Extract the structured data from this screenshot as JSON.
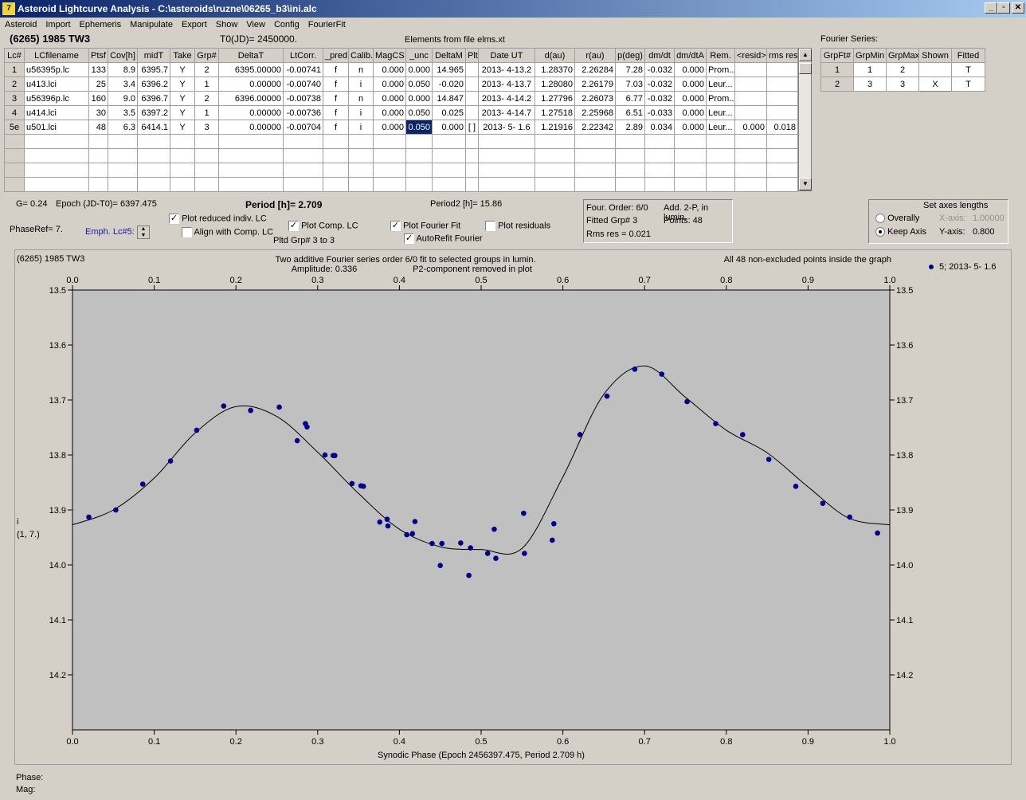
{
  "window": {
    "title": "Asteroid Lightcurve Analysis - C:\\asteroids\\ruzne\\06265_b3\\ini.alc",
    "icon_glyph": "7",
    "minimize": "_",
    "restore": "▫",
    "close": "✕"
  },
  "menu": [
    "Asteroid",
    "Import",
    "Ephemeris",
    "Manipulate",
    "Export",
    "Show",
    "View",
    "Config",
    "FourierFit"
  ],
  "header": {
    "asteroid": "(6265) 1985 TW3",
    "t0": "T0(JD)= 2450000.",
    "elements": "Elements from file elms.xt"
  },
  "lc_table": {
    "columns": [
      "Lc#",
      "LCfilename",
      "Ptsf",
      "Cov[h]",
      "midT",
      "Take",
      "Grp#",
      "DeltaT",
      "LtCorr.",
      "_pred.",
      "Calib.",
      "MagCS",
      "_unc",
      "DeltaM",
      "Plt",
      "Date UT",
      "d(au)",
      "r(au)",
      "p(deg)",
      "dm/dt",
      "dm/dtA",
      "Rem.",
      "<resid>",
      "rms res"
    ],
    "rows": [
      [
        "1",
        "u56395p.lc",
        "133",
        "8.9",
        "6395.7",
        "Y",
        "2",
        "6395.00000",
        "-0.00741",
        "f",
        "n",
        "0.000",
        "0.000",
        "14.965",
        "",
        "2013- 4-13.2",
        "1.28370",
        "2.26284",
        "7.28",
        "-0.032",
        "0.000",
        "Prom...",
        "",
        ""
      ],
      [
        "2",
        "u413.lci",
        "25",
        "3.4",
        "6396.2",
        "Y",
        "1",
        "0.00000",
        "-0.00740",
        "f",
        "i",
        "0.000",
        "0.050",
        "-0.020",
        "",
        "2013- 4-13.7",
        "1.28080",
        "2.26179",
        "7.03",
        "-0.032",
        "0.000",
        "Leur...",
        "",
        ""
      ],
      [
        "3",
        "u56396p.lc",
        "160",
        "9.0",
        "6396.7",
        "Y",
        "2",
        "6396.00000",
        "-0.00738",
        "f",
        "n",
        "0.000",
        "0.000",
        "14.847",
        "",
        "2013- 4-14.2",
        "1.27796",
        "2.26073",
        "6.77",
        "-0.032",
        "0.000",
        "Prom...",
        "",
        ""
      ],
      [
        "4",
        "u414.lci",
        "30",
        "3.5",
        "6397.2",
        "Y",
        "1",
        "0.00000",
        "-0.00736",
        "f",
        "i",
        "0.000",
        "0.050",
        "0.025",
        "",
        "2013- 4-14.7",
        "1.27518",
        "2.25968",
        "6.51",
        "-0.033",
        "0.000",
        "Leur...",
        "",
        ""
      ],
      [
        "5e",
        "u501.lci",
        "48",
        "6.3",
        "6414.1",
        "Y",
        "3",
        "0.00000",
        "-0.00704",
        "f",
        "i",
        "0.000",
        "0.050",
        "0.000",
        "[ ]",
        "2013- 5- 1.6",
        "1.21916",
        "2.22342",
        "2.89",
        "0.034",
        "0.000",
        "Leur...",
        "0.000",
        "0.018"
      ]
    ],
    "empty_rows": 4
  },
  "fourier_series": {
    "label": "Fourier Series:",
    "columns": [
      "GrpFt#",
      "GrpMin",
      "GrpMax",
      "Shown",
      "Fitted"
    ],
    "rows": [
      [
        "1",
        "1",
        "2",
        "",
        "T"
      ],
      [
        "2",
        "3",
        "3",
        "X",
        "T"
      ]
    ]
  },
  "controls": {
    "g": "G= 0.24",
    "epoch": "Epoch (JD-T0)= 6397.475",
    "period": "Period [h]= 2.709",
    "period2": "Period2 [h]= 15.86",
    "phaseref": "PhaseRef= 7.",
    "emph": "Emph. Lc#5:",
    "plot_reduced": "Plot reduced indiv. LC",
    "align_comp": "Align with Comp. LC",
    "plot_comp": "Plot Comp. LC",
    "pltd_grp": "Pltd Grp#  3  to  3",
    "plot_fourier": "Plot Fourier Fit",
    "autorefit": "AutoRefit Fourier",
    "plot_residuals": "Plot residuals",
    "four_order": "Four. Order:  6/0",
    "add_2p": "Add. 2-P, in lumin.",
    "fitted_grp": "Fitted Grp# 3",
    "points": "Points: 48",
    "rms_res": "Rms res    = 0.021",
    "axes_title": "Set axes lengths",
    "overally": "Overally",
    "keep_axis": "Keep Axis",
    "x_axis_label": "X-axis:",
    "x_axis_value": "1.00000",
    "y_axis_label": "Y-axis:",
    "y_axis_value": "0.800"
  },
  "footer": {
    "phase": "Phase:",
    "mag": "Mag:"
  },
  "colors": {
    "titlebar_start": "#0a246a",
    "titlebar_end": "#a6caf0",
    "face": "#d4d0c8",
    "plot_bg": "#c0c0c0",
    "points": "#00008b",
    "selection": "#0a246a"
  },
  "chart_data": {
    "type": "scatter",
    "title": "(6265) 1985 TW3",
    "subtitle_lines": [
      "Two additive Fourier series order 6/0 fit to selected groups in lumin.",
      "Amplitude: 0.336",
      "P2-component removed in plot"
    ],
    "note": "All 48 non-excluded points inside the graph",
    "legend": "5; 2013- 5- 1.6",
    "legend_position": "top-right",
    "xlabel": "Synodic Phase (Epoch 2456397.475, Period 2.709 h)",
    "ylabel_lines": [
      "i",
      "(1, 7.)"
    ],
    "xlim": [
      0.0,
      1.0
    ],
    "ylim": [
      13.5,
      14.3
    ],
    "y_inverted": true,
    "x_ticks": [
      "0.0",
      "0.1",
      "0.2",
      "0.3",
      "0.4",
      "0.5",
      "0.6",
      "0.7",
      "0.8",
      "0.9",
      "1.0"
    ],
    "y_ticks": [
      "13.5",
      "13.6",
      "13.7",
      "13.8",
      "13.9",
      "14.0",
      "14.1",
      "14.2"
    ],
    "points": {
      "x": [
        0.02,
        0.053,
        0.086,
        0.12,
        0.152,
        0.185,
        0.218,
        0.253,
        0.275,
        0.285,
        0.287,
        0.309,
        0.319,
        0.321,
        0.342,
        0.353,
        0.356,
        0.376,
        0.385,
        0.386,
        0.409,
        0.416,
        0.419,
        0.44,
        0.45,
        0.452,
        0.475,
        0.485,
        0.487,
        0.508,
        0.516,
        0.518,
        0.552,
        0.553,
        0.587,
        0.589,
        0.621,
        0.654,
        0.688,
        0.721,
        0.752,
        0.787,
        0.82,
        0.852,
        0.885,
        0.918,
        0.951,
        0.985
      ],
      "y": [
        13.913,
        13.9,
        13.853,
        13.811,
        13.755,
        13.711,
        13.719,
        13.713,
        13.774,
        13.743,
        13.749,
        13.8,
        13.801,
        13.801,
        13.852,
        13.856,
        13.857,
        13.922,
        13.917,
        13.929,
        13.945,
        13.943,
        13.921,
        13.961,
        14.001,
        13.961,
        13.96,
        14.019,
        13.969,
        13.979,
        13.935,
        13.988,
        13.906,
        13.979,
        13.955,
        13.925,
        13.763,
        13.693,
        13.644,
        13.653,
        13.703,
        13.743,
        13.763,
        13.808,
        13.857,
        13.888,
        13.913,
        13.942
      ]
    },
    "fit_curve": {
      "x": [
        0.0,
        0.05,
        0.1,
        0.15,
        0.2,
        0.25,
        0.3,
        0.35,
        0.4,
        0.45,
        0.5,
        0.55,
        0.6,
        0.65,
        0.7,
        0.75,
        0.8,
        0.85,
        0.9,
        0.95,
        1.0
      ],
      "y": [
        13.927,
        13.9,
        13.842,
        13.76,
        13.712,
        13.73,
        13.795,
        13.87,
        13.935,
        13.967,
        13.972,
        13.97,
        13.84,
        13.69,
        13.638,
        13.695,
        13.755,
        13.796,
        13.858,
        13.915,
        13.927
      ]
    }
  }
}
